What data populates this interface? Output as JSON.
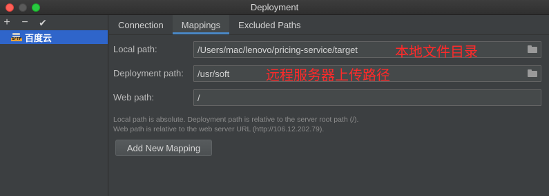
{
  "window": {
    "title": "Deployment"
  },
  "toolbar": {
    "add": "+",
    "remove": "−",
    "apply": "✔"
  },
  "servers": [
    {
      "label": "百度云",
      "icon": "sftp-server-icon",
      "badge": "SFTP"
    }
  ],
  "tabs": [
    {
      "label": "Connection",
      "active": false
    },
    {
      "label": "Mappings",
      "active": true
    },
    {
      "label": "Excluded Paths",
      "active": false
    }
  ],
  "mappings": {
    "local_path": {
      "label": "Local path:",
      "value": "/Users/mac/lenovo/pricing-service/target",
      "annotation": "本地文件目录"
    },
    "deployment_path": {
      "label": "Deployment path:",
      "value": "/usr/soft",
      "annotation": "远程服务器上传路径"
    },
    "web_path": {
      "label": "Web path:",
      "value": "/"
    },
    "hint_line1": "Local path is absolute. Deployment path is relative to the server root path (/).",
    "hint_line2": "Web path is relative to the web server URL (http://106.12.202.79).",
    "add_button": "Add New Mapping"
  },
  "colors": {
    "selection": "#2f65ca",
    "tab_underline": "#4a88c7",
    "annotation": "#ff2a2a"
  }
}
